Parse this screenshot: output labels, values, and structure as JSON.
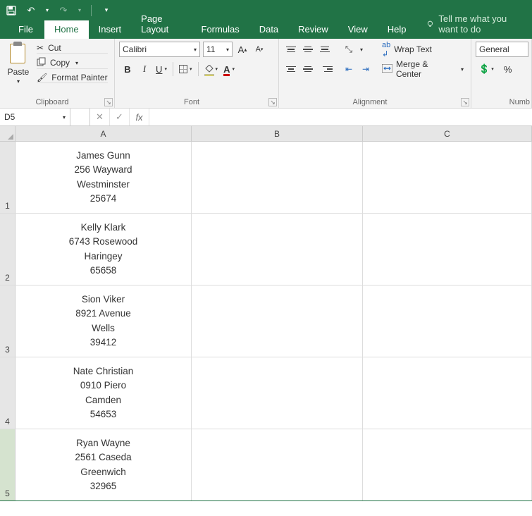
{
  "qat": {
    "save": "save",
    "undo": "undo",
    "redo": "redo"
  },
  "tabs": {
    "file": "File",
    "home": "Home",
    "insert": "Insert",
    "page_layout": "Page Layout",
    "formulas": "Formulas",
    "data": "Data",
    "review": "Review",
    "view": "View",
    "help": "Help",
    "tell_me": "Tell me what you want to do"
  },
  "ribbon": {
    "clipboard": {
      "paste": "Paste",
      "cut": "Cut",
      "copy": "Copy",
      "format_painter": "Format Painter",
      "group": "Clipboard"
    },
    "font": {
      "name": "Calibri",
      "size": "11",
      "group": "Font"
    },
    "alignment": {
      "wrap": "Wrap Text",
      "merge": "Merge & Center",
      "group": "Alignment"
    },
    "number": {
      "format": "General",
      "group": "Numb",
      "percent": "%"
    }
  },
  "namebox": "D5",
  "formula": "",
  "columns": [
    "A",
    "B",
    "C"
  ],
  "rows": [
    {
      "n": "1",
      "a": [
        "James Gunn",
        "256 Wayward",
        "Westminster",
        "25674"
      ]
    },
    {
      "n": "2",
      "a": [
        "Kelly Klark",
        "6743 Rosewood",
        "Haringey",
        "65658"
      ]
    },
    {
      "n": "3",
      "a": [
        "Sion Viker",
        "8921 Avenue",
        "Wells",
        "39412"
      ]
    },
    {
      "n": "4",
      "a": [
        "Nate Christian",
        "0910 Piero",
        "Camden",
        "54653"
      ]
    },
    {
      "n": "5",
      "a": [
        "Ryan Wayne",
        "2561 Caseda",
        "Greenwich",
        "32965"
      ]
    }
  ]
}
